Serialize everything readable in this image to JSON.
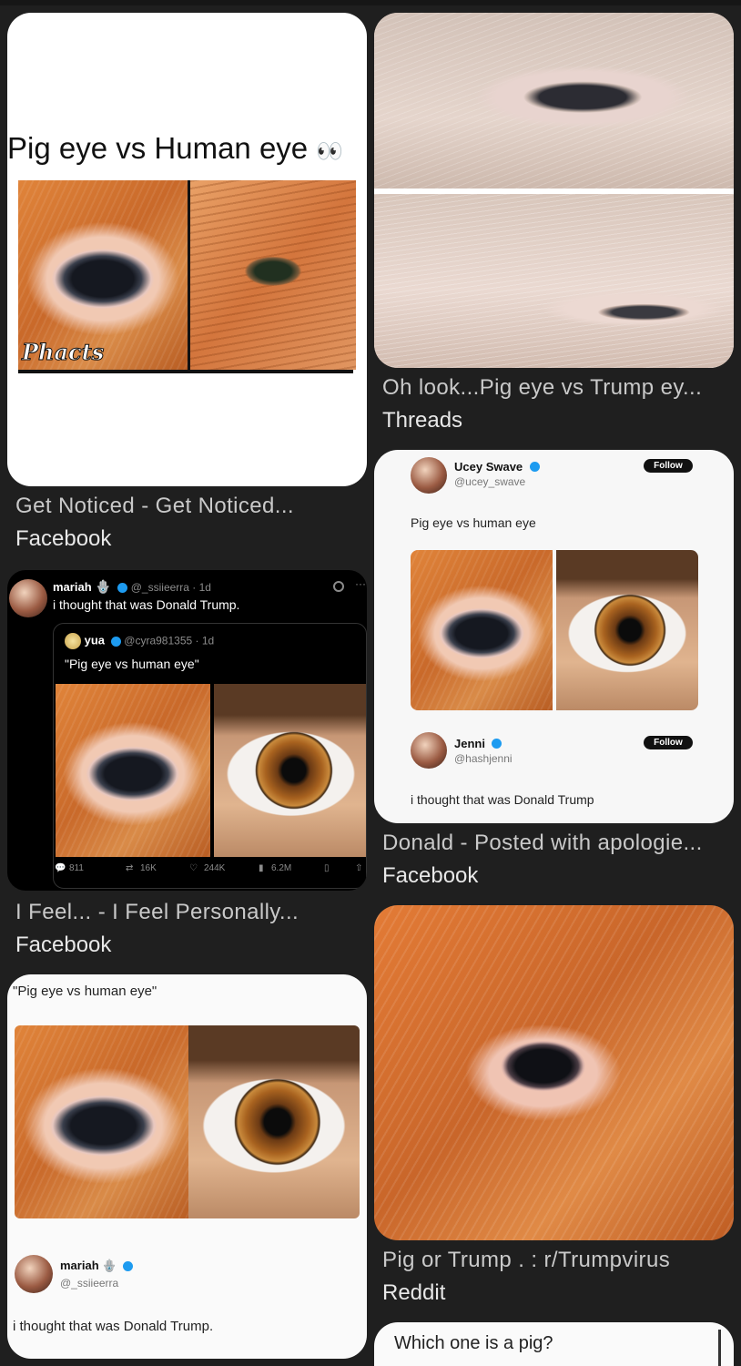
{
  "results": [
    {
      "title": "Get Noticed - Get Noticed...",
      "source": "Facebook",
      "image_text": "Pig eye vs Human eye",
      "image_emoji": "👀",
      "watermark": "Phacts"
    },
    {
      "title": "Oh look...Pig eye vs Trump ey...",
      "source": "Threads"
    },
    {
      "title": "I Feel... - I Feel Personally...",
      "source": "Facebook",
      "tweet": {
        "name": "mariah",
        "emoji": "🪬",
        "handle": "@_ssiieerra · 1d",
        "text": "i thought that was Donald Trump.",
        "quoted_name": "yua",
        "quoted_handle": "@cyra981355 · 1d",
        "quoted_text": "\"Pig eye vs human eye\"",
        "stats": {
          "replies": "811",
          "reposts": "16K",
          "likes": "244K",
          "views": "6.2M"
        }
      }
    },
    {
      "title": "Donald - Posted with apologie...",
      "source": "Facebook",
      "tweet": {
        "name": "Ucey Swave",
        "handle": "@ucey_swave",
        "text": "Pig eye vs human eye",
        "follow_label": "Follow",
        "reply_name": "Jenni",
        "reply_handle": "@hashjenni",
        "reply_text": "i thought that was Donald Trump"
      }
    },
    {
      "tweet": {
        "quote": "\"Pig eye vs human eye\"",
        "name": "mariah",
        "emoji": "🪬",
        "handle": "@_ssiieerra",
        "text": "i thought that was Donald Trump."
      }
    },
    {
      "title": "Pig or Trump . : r/Trumpvirus",
      "source": "Reddit"
    },
    {
      "image_text": "Which one is a pig?"
    }
  ],
  "colors": {
    "background": "#1f1f1f",
    "caption_title": "#c9c9c9",
    "caption_source": "#e8e8e8",
    "verified": "#1d9bf0"
  }
}
